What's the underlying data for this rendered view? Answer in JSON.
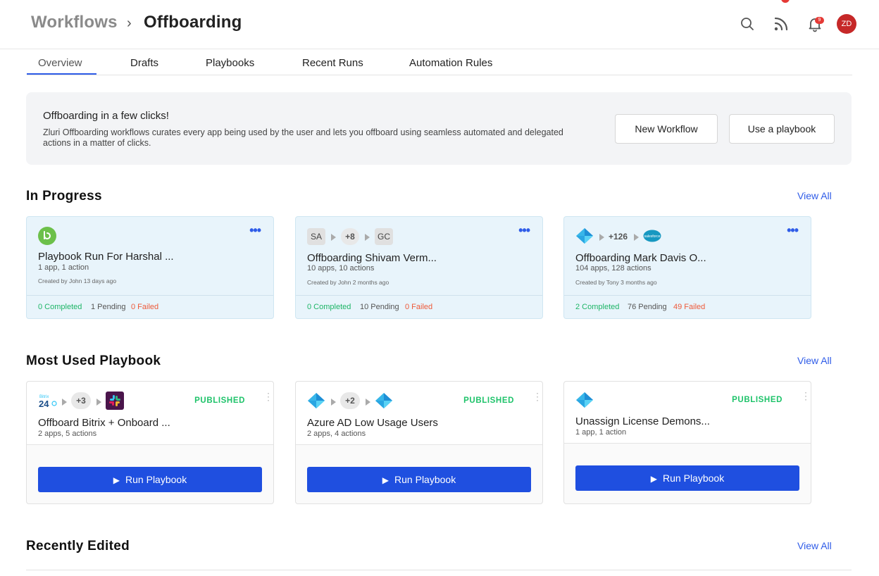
{
  "header": {
    "breadcrumb_root": "Workflows",
    "breadcrumb_separator": "›",
    "breadcrumb_current": "Offboarding",
    "notification_count": "9",
    "avatar_initials": "ZD"
  },
  "tabs": [
    {
      "label": "Overview",
      "active": true
    },
    {
      "label": "Drafts"
    },
    {
      "label": "Playbooks"
    },
    {
      "label": "Recent Runs"
    },
    {
      "label": "Automation Rules"
    }
  ],
  "banner": {
    "title": "Offboarding in a few clicks!",
    "description": "Zluri Offboarding workflows curates every app being used by the user and lets you offboard using seamless automated and delegated actions in a matter of clicks.",
    "new_workflow": "New Workflow",
    "use_playbook": "Use a playbook"
  },
  "in_progress": {
    "title": "In Progress",
    "view_all": "View All",
    "cards": [
      {
        "icons": [
          "bamboohr-icon"
        ],
        "name": "Playbook Run For Harshal ...",
        "summary": "1 app, 1 action",
        "meta": "Created by John 13 days ago",
        "completed": "0 Completed",
        "pending": "1 Pending",
        "failed": "0 Failed"
      },
      {
        "chip_left": "SA",
        "more_count": "+8",
        "chip_right": "GC",
        "name": "Offboarding Shivam Verm...",
        "summary": "10 apps, 10 actions",
        "meta": "Created by John 2 months ago",
        "completed": "0 Completed",
        "pending": "10 Pending",
        "failed": "0 Failed"
      },
      {
        "more_count": "+126",
        "icons": [
          "azure-ad-icon",
          "salesforce-icon"
        ],
        "salesforce_label": "salesforce",
        "name": "Offboarding Mark Davis O...",
        "summary": "104 apps, 128 actions",
        "meta": "Created by Tony 3 months ago",
        "completed": "2 Completed",
        "pending": "76 Pending",
        "failed": "49 Failed"
      }
    ]
  },
  "most_used": {
    "title": "Most Used Playbook",
    "view_all": "View All",
    "cards": [
      {
        "bitrix_top": "Bitrix",
        "bitrix_num": "24",
        "more_count": "+3",
        "icons": [
          "bitrix24-icon",
          "slack-icon"
        ],
        "status": "PUBLISHED",
        "name": "Offboard Bitrix + Onboard ...",
        "summary": "2 apps, 5 actions",
        "run_label": "Run Playbook"
      },
      {
        "more_count": "+2",
        "icons": [
          "azure-ad-icon",
          "azure-ad-icon"
        ],
        "status": "PUBLISHED",
        "name": "Azure AD Low Usage Users",
        "summary": "2 apps, 4 actions",
        "run_label": "Run Playbook"
      },
      {
        "icons": [
          "azure-ad-icon"
        ],
        "status": "PUBLISHED",
        "name": "Unassign License Demons...",
        "summary": "1 app, 1 action",
        "run_label": "Run Playbook"
      }
    ]
  },
  "recently_edited": {
    "title": "Recently Edited",
    "view_all": "View All"
  },
  "colors": {
    "accent": "#2f5ce8",
    "run_button": "#1f4fe0",
    "published": "#1ec36a",
    "completed": "#1eb567",
    "failed": "#ee5a3a",
    "progress_card_bg": "#e8f4fb"
  }
}
